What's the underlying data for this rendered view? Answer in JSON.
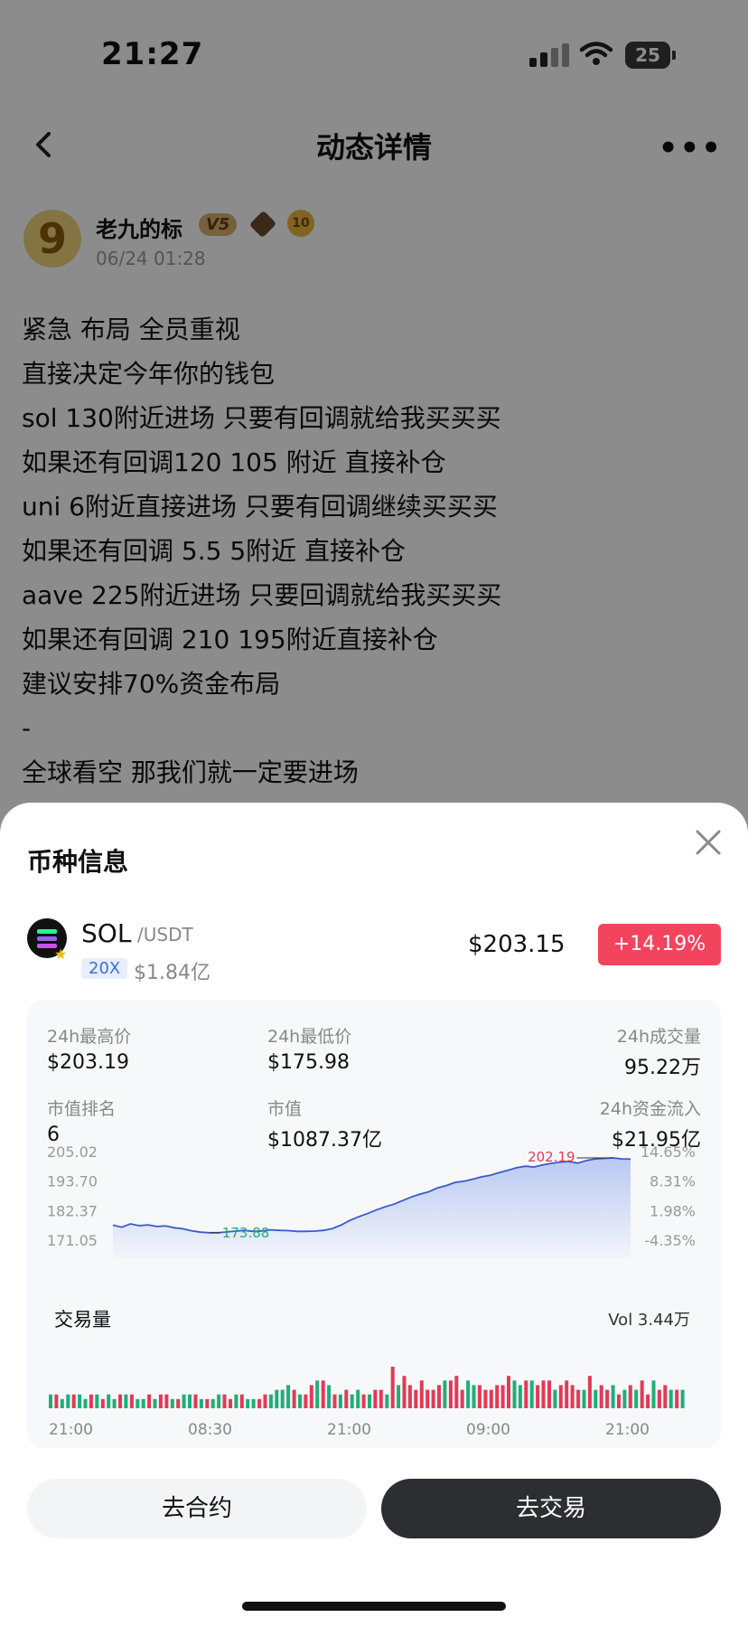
{
  "status_bar": {
    "time": "21:27",
    "battery": "25"
  },
  "nav": {
    "title": "动态详情"
  },
  "author": {
    "avatar_text": "9",
    "name": "老九的标",
    "vip_badge": "V5",
    "level_badge": "10",
    "post_time": "06/24 01:28"
  },
  "post": {
    "lines": [
      "紧急 布局 全员重视",
      "直接决定今年你的钱包",
      "sol 130附近进场 只要有回调就给我买买买",
      "如果还有回调120 105 附近 直接补仓",
      "uni 6附近直接进场 只要有回调继续买买买",
      "如果还有回调 5.5 5附近 直接补仓",
      "aave 225附近进场 只要回调就给我买买买",
      "如果还有回调 210 195附近直接补仓",
      "建议安排70%资金布局",
      "-",
      "全球看空 那我们就一定要进场"
    ]
  },
  "sheet": {
    "title": "币种信息",
    "coin": {
      "symbol": "SOL",
      "quote": "/USDT",
      "leverage": "20X",
      "small_cap": "$1.84亿",
      "price": "$203.15",
      "change": "+14.19%"
    },
    "stats": {
      "high_label": "24h最高价",
      "high_value": "$203.19",
      "low_label": "24h最低价",
      "low_value": "$175.98",
      "volume_label": "24h成交量",
      "volume_value": "95.22万",
      "rank_label": "市值排名",
      "rank_value": "6",
      "mcap_label": "市值",
      "mcap_value": "$1087.37亿",
      "inflow_label": "24h资金流入",
      "inflow_value": "$21.95亿"
    },
    "volume_title": "交易量",
    "volume_value": "Vol 3.44万",
    "buttons": {
      "contract": "去合约",
      "trade": "去交易"
    }
  },
  "colors": {
    "up": "#e23a55",
    "down": "#1fae78",
    "line": "#3a5bc7"
  },
  "chart_data": [
    {
      "type": "line",
      "y_left_ticks": [
        "205.02",
        "193.70",
        "182.37",
        "171.05"
      ],
      "y_right_ticks": [
        "14.65%",
        "8.31%",
        "1.98%",
        "-4.35%"
      ],
      "ylim": [
        171.05,
        205.02
      ],
      "max_label": "202.19",
      "min_label": "173.88",
      "values": [
        176.8,
        176.0,
        177.3,
        176.6,
        176.9,
        176.3,
        176.5,
        175.8,
        175.4,
        174.6,
        174.1,
        173.9,
        173.9,
        174.2,
        174.5,
        174.8,
        174.4,
        174.6,
        175.0,
        174.8,
        174.7,
        174.4,
        174.4,
        174.5,
        174.8,
        175.5,
        176.8,
        178.6,
        180.0,
        181.2,
        182.6,
        183.8,
        184.8,
        186.2,
        187.6,
        188.7,
        189.6,
        191.1,
        192.0,
        193.2,
        193.6,
        194.4,
        195.3,
        195.9,
        196.9,
        197.8,
        198.8,
        199.4,
        199.1,
        199.9,
        200.5,
        201.0,
        201.2,
        200.6,
        201.6,
        202.2,
        202.4,
        202.6,
        202.2,
        202.1
      ]
    },
    {
      "type": "bar",
      "x_ticks": [
        "21:00",
        "08:30",
        "21:00",
        "09:00",
        "21:00"
      ],
      "values": [
        3,
        3,
        2,
        3,
        3,
        3,
        2,
        3,
        3,
        2,
        3,
        2,
        3,
        3,
        3,
        2,
        2,
        3,
        2,
        3,
        3,
        2,
        2,
        3,
        3,
        3,
        2,
        2,
        2,
        3,
        3,
        2,
        3,
        3,
        2,
        2,
        2,
        3,
        3,
        4,
        4,
        5,
        4,
        3,
        3,
        5,
        6,
        6,
        5,
        3,
        3,
        4,
        3,
        4,
        3,
        3,
        4,
        4,
        3,
        9,
        5,
        7,
        5,
        4,
        6,
        4,
        4,
        5,
        6,
        6,
        7,
        4,
        6,
        5,
        5,
        4,
        4,
        5,
        5,
        7,
        6,
        5,
        6,
        6,
        5,
        6,
        6,
        4,
        5,
        6,
        5,
        4,
        4,
        7,
        4,
        5,
        4,
        5,
        3,
        4,
        5,
        4,
        6,
        3,
        6,
        4,
        5,
        4,
        4,
        4
      ],
      "up": [
        1,
        0,
        1,
        1,
        0,
        1,
        1,
        0,
        1,
        0,
        1,
        1,
        0,
        1,
        0,
        1,
        1,
        0,
        1,
        0,
        0,
        1,
        0,
        1,
        1,
        0,
        1,
        0,
        1,
        1,
        0,
        0,
        1,
        0,
        1,
        1,
        0,
        0,
        1,
        1,
        1,
        1,
        0,
        1,
        0,
        0,
        1,
        0,
        1,
        0,
        1,
        0,
        1,
        1,
        0,
        1,
        0,
        0,
        1,
        0,
        1,
        0,
        0,
        0,
        0,
        0,
        0,
        0,
        1,
        0,
        0,
        0,
        1,
        1,
        0,
        0,
        0,
        0,
        0,
        0,
        1,
        1,
        0,
        1,
        0,
        0,
        0,
        1,
        0,
        0,
        0,
        0,
        1,
        0,
        1,
        0,
        0,
        1,
        0,
        1,
        0,
        1,
        0,
        0,
        1,
        0,
        0,
        1,
        0,
        1
      ]
    }
  ]
}
